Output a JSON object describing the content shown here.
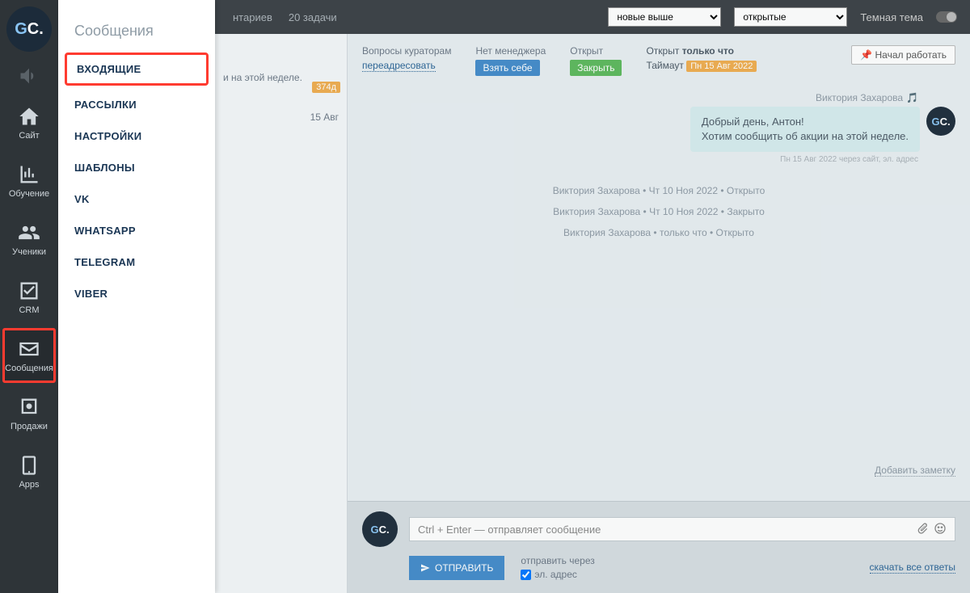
{
  "topbar": {
    "link_comments": "нтариев",
    "link_tasks": "20 задачи",
    "sort_options": [
      "новые выше"
    ],
    "filter_options": [
      "открытые"
    ],
    "theme_label": "Темная тема"
  },
  "rail": {
    "items": [
      {
        "key": "site",
        "label": "Сайт"
      },
      {
        "key": "training",
        "label": "Обучение"
      },
      {
        "key": "students",
        "label": "Ученики"
      },
      {
        "key": "crm",
        "label": "CRM"
      },
      {
        "key": "messages",
        "label": "Сообщения"
      },
      {
        "key": "sales",
        "label": "Продажи"
      },
      {
        "key": "apps",
        "label": "Apps"
      }
    ]
  },
  "submenu": {
    "title": "Сообщения",
    "items": [
      "ВХОДЯЩИЕ",
      "РАССЫЛКИ",
      "НАСТРОЙКИ",
      "ШАБЛОНЫ",
      "VK",
      "WHATSAPP",
      "TELEGRAM",
      "VIBER"
    ]
  },
  "convlist": {
    "badge_days": "374д",
    "snippet": "и на этой неделе.",
    "date": "15 Авг"
  },
  "header": {
    "curators_label": "Вопросы кураторам",
    "forward": "переадресовать",
    "no_manager": "Нет менеджера",
    "take": "Взять себе",
    "open_label": "Открыт",
    "close": "Закрыть",
    "opened_label": "Открыт",
    "just_now": "только что",
    "timeout_label": "Таймаут",
    "timeout_value": "Пн 15 Авг 2022",
    "start_work": "Начал работать",
    "pin": "📌"
  },
  "conversation": {
    "sender": "Виктория Захарова",
    "sender_icon": "🎵",
    "bubble_line1": "Добрый день, Антон!",
    "bubble_line2": "Хотим сообщить об акции на этой неделе.",
    "msg_meta": "Пн 15 Авг 2022 через сайт, эл. адрес",
    "log1": "Виктория Захарова • Чт 10 Ноя 2022 • Открыто",
    "log2": "Виктория Захарова • Чт 10 Ноя 2022 • Закрыто",
    "log3": "Виктория Захарова • только что • Открыто",
    "add_note": "Добавить заметку"
  },
  "composer": {
    "placeholder": "Ctrl + Enter — отправляет сообщение",
    "send": "ОТПРАВИТЬ",
    "send_via_label": "отправить через",
    "email_label": "эл. адрес",
    "download_all": "скачать все ответы"
  }
}
